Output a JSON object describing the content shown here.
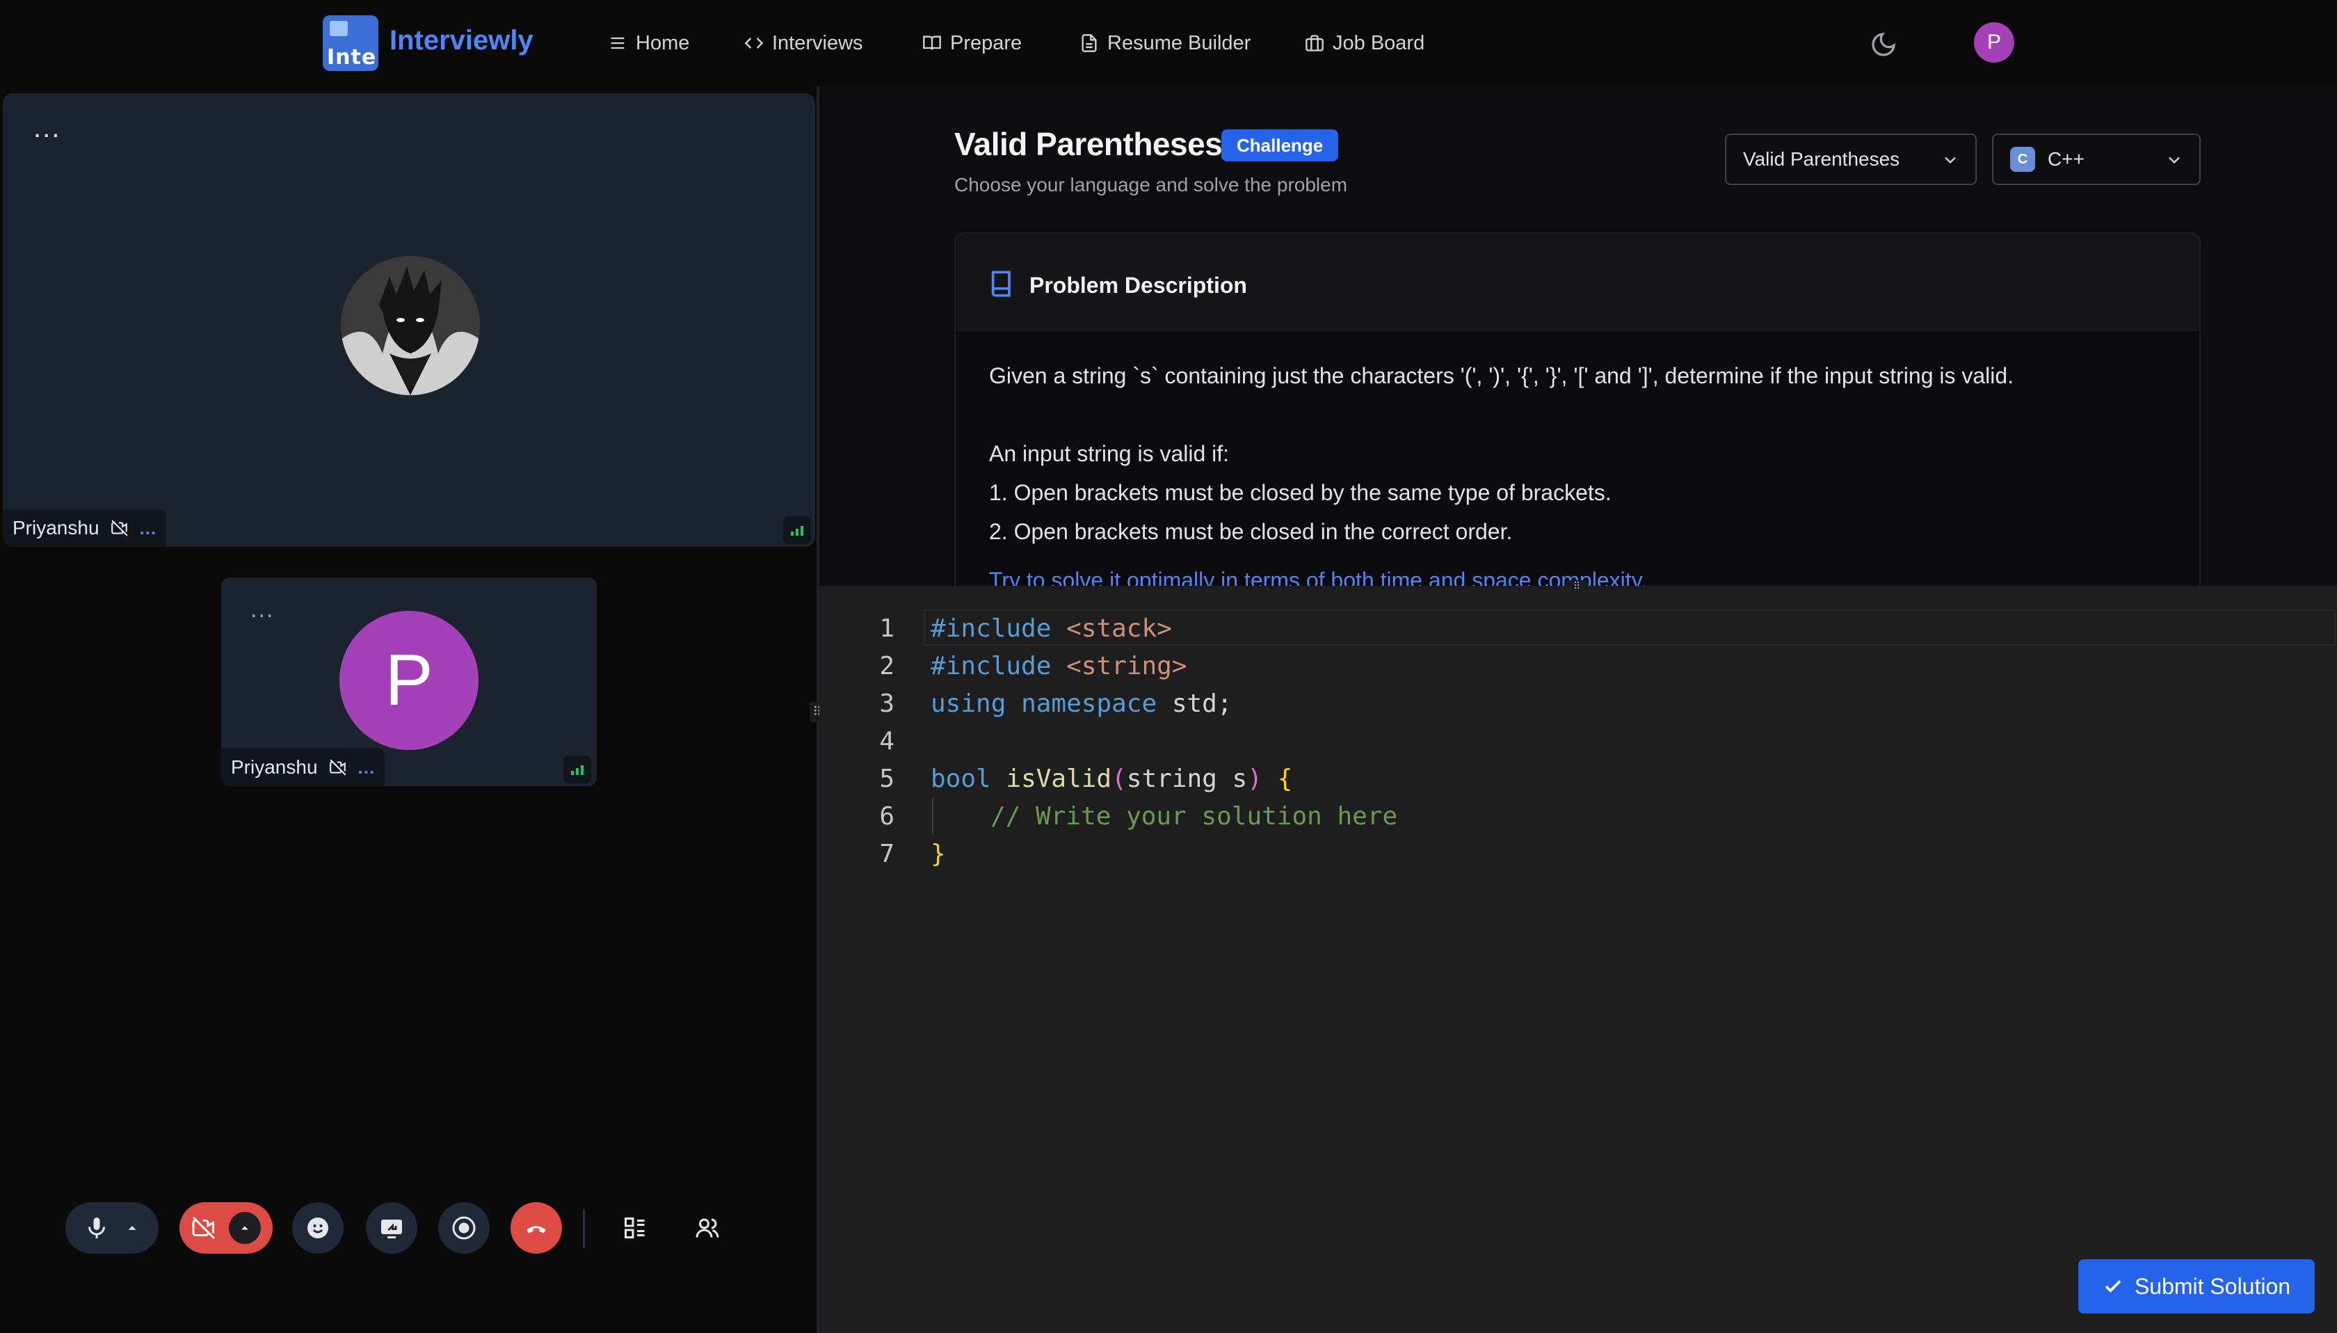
{
  "navbar": {
    "logo_alt": "Inte",
    "brand": "Interviewly",
    "items": [
      {
        "label": "Home",
        "icon": "menu-icon"
      },
      {
        "label": "Interviews",
        "icon": "code-icon"
      },
      {
        "label": "Prepare",
        "icon": "book-open-icon"
      },
      {
        "label": "Resume Builder",
        "icon": "file-text-icon"
      },
      {
        "label": "Job Board",
        "icon": "briefcase-icon"
      }
    ],
    "theme_icon": "moon-icon",
    "user_initial": "P"
  },
  "call": {
    "tile_main": {
      "more": "...",
      "name": "Priyanshu"
    },
    "tile_small": {
      "more": "...",
      "name": "Priyanshu",
      "initial": "P"
    },
    "name_tag_more": "...",
    "controls": [
      "microphone-icon",
      "camera-off-icon",
      "reaction-icon",
      "screen-share-icon",
      "record-icon",
      "end-call-icon",
      "layout-icon",
      "participants-icon"
    ]
  },
  "problem": {
    "title": "Valid Parentheses",
    "badge": "Challenge",
    "subtitle": "Choose your language and solve the problem",
    "problem_select": "Valid Parentheses",
    "language_select": "C++",
    "language_icon_text": "C",
    "description_heading": "Problem Description",
    "description": {
      "line1": "Given a string `s` containing just the characters '(', ')', '{', '}', '[' and ']', determine if the input string is valid.",
      "line2": "An input string is valid if:",
      "line3": "1. Open brackets must be closed by the same type of brackets.",
      "line4": "2. Open brackets must be closed in the correct order.",
      "hint": "Try to solve it optimally in terms of both time and space complexity."
    }
  },
  "editor": {
    "line_numbers": [
      "1",
      "2",
      "3",
      "4",
      "5",
      "6",
      "7"
    ],
    "lines": {
      "l1_directive": "#include",
      "l1_header": "<stack>",
      "l2_directive": "#include",
      "l2_header": "<string>",
      "l3_kw1": "using",
      "l3_kw2": "namespace",
      "l3_rest": "std;",
      "l5_type": "bool",
      "l5_fn": "isValid",
      "l5_open": "(",
      "l5_param": "string s",
      "l5_close": ")",
      "l5_brace": "{",
      "l6_comment": "// Write your solution here",
      "l7_brace": "}"
    }
  },
  "submit_label": "Submit Solution",
  "colors": {
    "accent": "#2563eb",
    "brand": "#4f86f7",
    "end_call": "#dc4c44",
    "avatar": "#a440b8"
  }
}
